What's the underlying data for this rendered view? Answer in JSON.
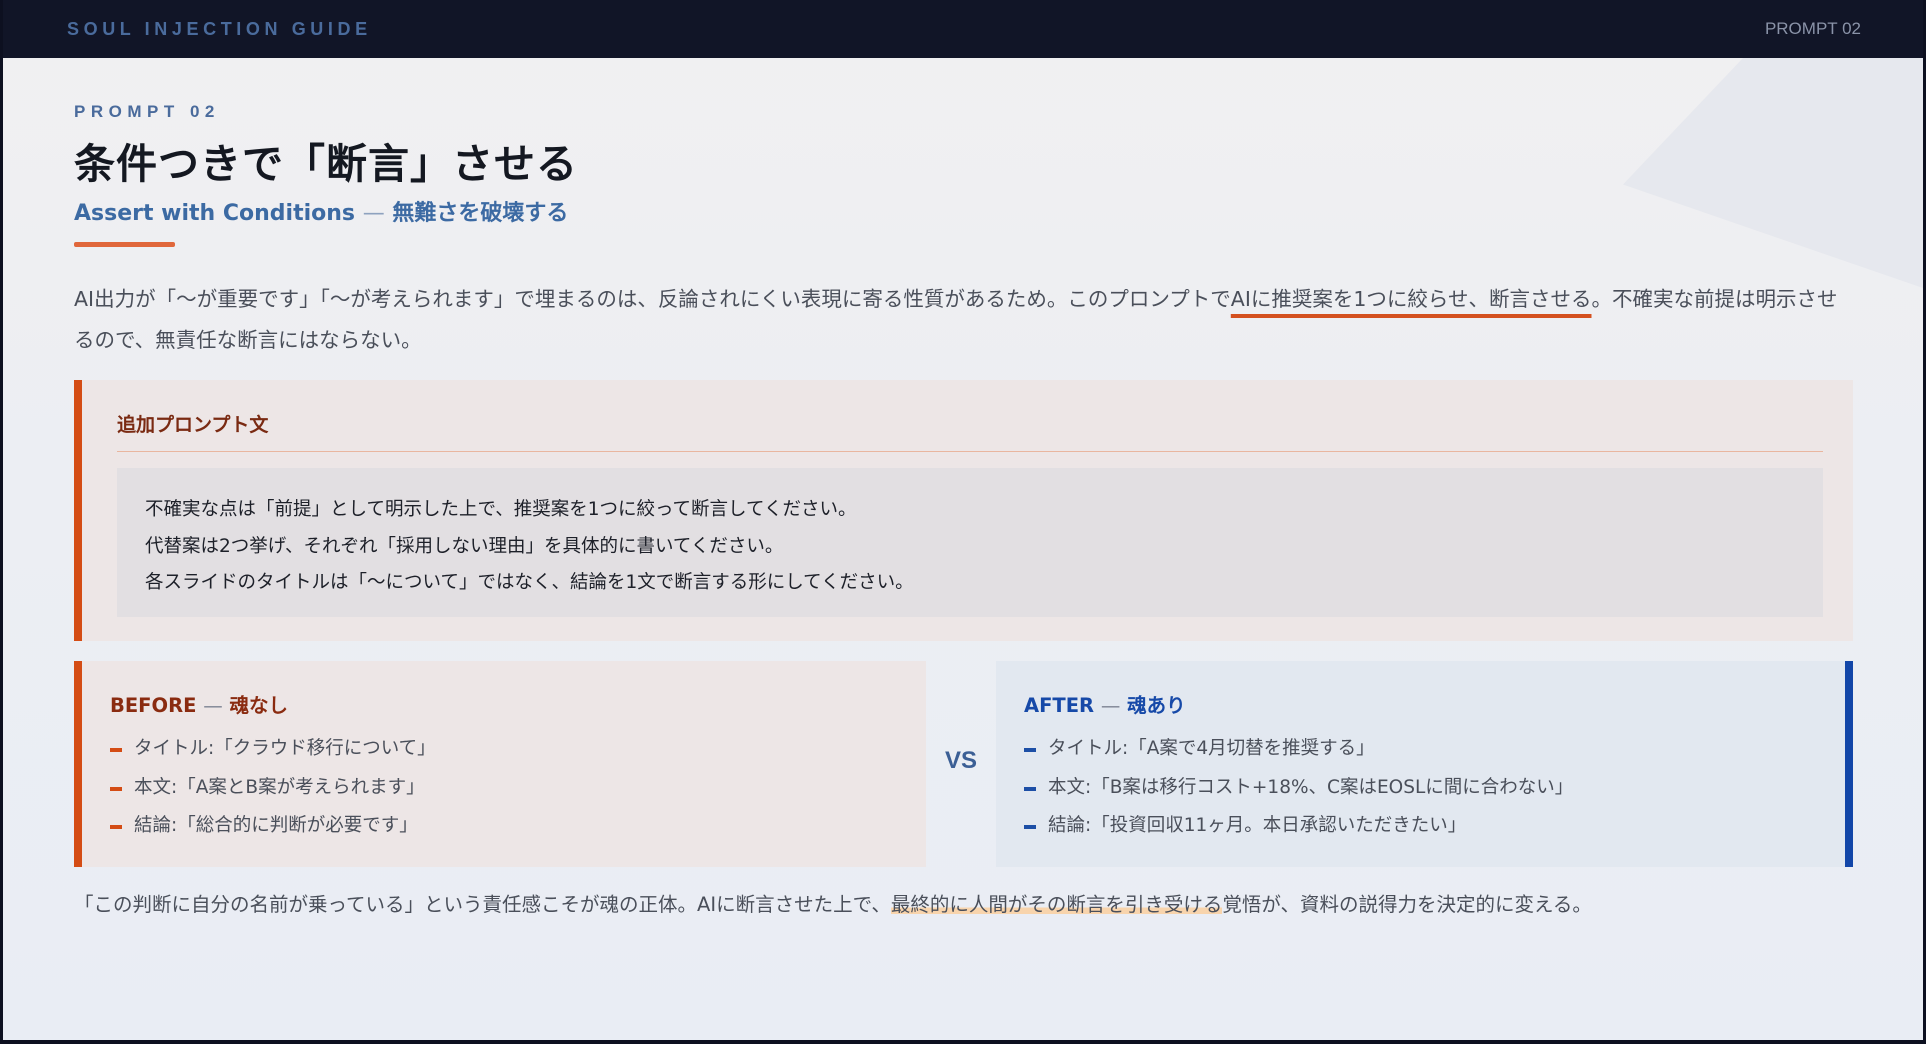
{
  "header": {
    "brand": "SOUL INJECTION GUIDE",
    "page_tag": "PROMPT 02"
  },
  "hero": {
    "kicker": "PROMPT 02",
    "title": "条件つきで「断言」させる",
    "subtitle_en": "Assert with Conditions",
    "subtitle_dash": "—",
    "subtitle_ja": "無難さを破壊する"
  },
  "lead": {
    "before": "AI出力が「〜が重要です」「〜が考えられます」で埋まるのは、反論されにくい表現に寄る性質があるため。このプロンプトで",
    "emphasis": "AIに推奨案を1つに絞らせ、断言させる",
    "after": "。不確実な前提は明示させるので、無責任な断言にはならない。"
  },
  "prompt": {
    "label": "追加プロンプト文",
    "lines": [
      "不確実な点は「前提」として明示した上で、推奨案を1つに絞って断言してください。",
      "代替案は2つ挙げ、それぞれ「採用しない理由」を具体的に書いてください。",
      "各スライドのタイトルは「〜について」ではなく、結論を1文で断言する形にしてください。"
    ]
  },
  "comparison": {
    "vs": "VS",
    "before": {
      "head": "BEFORE",
      "dash": "—",
      "tag": "魂なし",
      "items": [
        "タイトル:「クラウド移行について」",
        "本文:「A案とB案が考えられます」",
        "結論:「総合的に判断が必要です」"
      ]
    },
    "after": {
      "head": "AFTER",
      "dash": "—",
      "tag": "魂あり",
      "items": [
        "タイトル:「A案で4月切替を推奨する」",
        "本文:「B案は移行コスト+18%、C案はEOSLに間に合わない」",
        "結論:「投資回収11ヶ月。本日承認いただきたい」"
      ]
    }
  },
  "footer": {
    "before": "「この判断に自分の名前が乗っている」という責任感こそが魂の正体。AIに断言させた上で、",
    "highlight": "最終的に人間がその断言を引き受ける",
    "after": "覚悟が、資料の説得力を決定的に変える。"
  },
  "colors": {
    "accent_orange": "#d44c14",
    "accent_blue": "#1246a8",
    "navy_bar": "#111527",
    "highlight": "#f8d4ac"
  }
}
